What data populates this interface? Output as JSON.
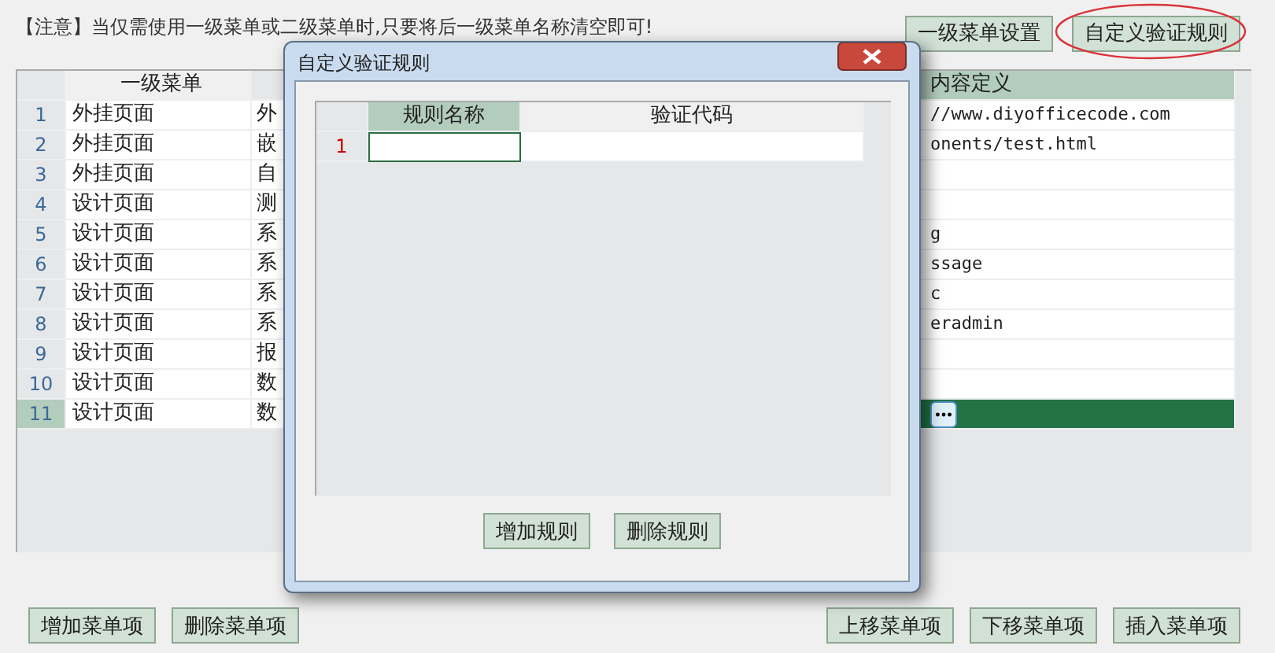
{
  "notice": "【注意】当仅需使用一级菜单或二级菜单时,只要将后一级菜单名称清空即可!",
  "top_buttons": [
    {
      "label": "一级菜单设置",
      "highlighted": false
    },
    {
      "label": "自定义验证规则",
      "highlighted": true
    }
  ],
  "table": {
    "columns": [
      "一级菜单",
      "内容定义"
    ],
    "rows": [
      {
        "number": "1",
        "level1": "外挂页面",
        "column_2": "外",
        "content": "//www.diyofficecode.com",
        "selected": false
      },
      {
        "number": "2",
        "level1": "外挂页面",
        "column_2": "嵌",
        "content": "onents/test.html",
        "selected": false
      },
      {
        "number": "3",
        "level1": "外挂页面",
        "column_2": "自",
        "selected": false
      },
      {
        "number": "4",
        "level1": "设计页面",
        "column_2": "测",
        "selected": false
      },
      {
        "number": "5",
        "level1": "设计页面",
        "column_2": "系",
        "content": "g",
        "selected": false
      },
      {
        "number": "6",
        "level1": "设计页面",
        "column_2": "系",
        "content": "ssage",
        "selected": false
      },
      {
        "number": "7",
        "level1": "设计页面",
        "column_2": "系",
        "content": "c",
        "selected": false
      },
      {
        "number": "8",
        "level1": "设计页面",
        "column_2": "系",
        "content": "eradmin",
        "selected": false
      },
      {
        "number": "9",
        "level1": "设计页面",
        "column_2": "报",
        "selected": false
      },
      {
        "number": "10",
        "level1": "设计页面",
        "column_2": "数",
        "selected": false
      },
      {
        "number": "11",
        "level1": "设计页面",
        "column_2": "数",
        "selected": true
      }
    ]
  },
  "bottom_buttons_left": [
    "增加菜单项",
    "删除菜单项"
  ],
  "bottom_buttons_right": [
    "上移菜单项",
    "下移菜单项",
    "插入菜单项"
  ],
  "dialog": {
    "title": "自定义验证规则",
    "columns": [
      "规则名称",
      "验证代码"
    ],
    "rows": [
      {
        "number": "1"
      }
    ],
    "buttons": [
      "增加规则",
      "删除规则"
    ]
  }
}
